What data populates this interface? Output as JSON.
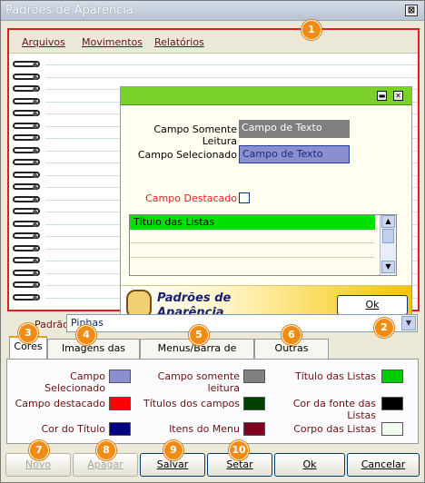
{
  "window": {
    "title": "Padrões de Aparência",
    "close_glyph": "⊠"
  },
  "menu": {
    "items": [
      "Arquivos",
      "Movimentos",
      "Relatórios"
    ]
  },
  "preview": {
    "fields": {
      "somente_leitura_label": "Campo Somente Leitura",
      "somente_leitura_value": "Campo de Texto",
      "selecionado_label": "Campo Selecionado",
      "selecionado_value": "Campo de Texto",
      "destacado_label": "Campo Destacado"
    },
    "list_title": "Título das Listas",
    "footer_title": "Padrões de Aparência",
    "ok_label": "Ok"
  },
  "padrao": {
    "label": "Padrão",
    "value": "Pinhas"
  },
  "tabs": [
    "Cores",
    "Imagens das Telas",
    "Menus/Barra de atalhos",
    "Outras Opções"
  ],
  "colors": {
    "col1": [
      {
        "label": "Campo Selecionado",
        "color": "#8b8fd0"
      },
      {
        "label": "Campo destacado",
        "color": "#ff0000"
      },
      {
        "label": "Cor do Título",
        "color": "#000080"
      }
    ],
    "col2": [
      {
        "label": "Campo somente leitura",
        "color": "#808080"
      },
      {
        "label": "Títulos dos campos",
        "color": "#004000"
      },
      {
        "label": "Itens do Menu",
        "color": "#800020"
      }
    ],
    "col3": [
      {
        "label": "Título das Listas",
        "color": "#00cc00"
      },
      {
        "label": "Cor da fonte das Listas",
        "color": "#000000"
      },
      {
        "label": "Corpo das Listas",
        "color": "#f0fff0"
      }
    ]
  },
  "buttons": {
    "novo": "Novo",
    "apagar": "Apagar",
    "salvar": "Salvar",
    "setar": "Setar",
    "ok": "Ok",
    "cancelar": "Cancelar"
  },
  "badges": [
    "1",
    "2",
    "3",
    "4",
    "5",
    "6",
    "7",
    "8",
    "9",
    "10"
  ],
  "accent_colors": {
    "highlight_border": "#e02020",
    "badge": "#f08c14"
  }
}
